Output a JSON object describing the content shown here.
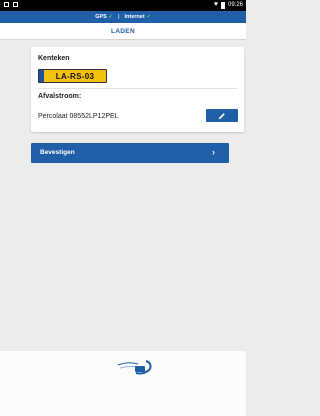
{
  "status_bar": {
    "time": "09:26"
  },
  "connection": {
    "gps_label": "GPS",
    "internet_label": "Internet",
    "gps_ok_icon": "check-icon",
    "internet_ok_icon": "check-icon"
  },
  "header": {
    "title": "LADEN"
  },
  "card": {
    "kenteken_label": "Kenteken",
    "kenteken_value": "LA-RS-03",
    "afvalstroom_label": "Afvalstroom:",
    "afvalstroom_value": "Percolaat 08552LP12PEL",
    "edit_icon": "pencil-icon"
  },
  "confirm": {
    "label": "Bevestigen",
    "arrow_icon": "chevron-right-icon"
  },
  "colors": {
    "primary": "#1f5fa7",
    "plate_yellow": "#f4c20d",
    "ok_green": "#4fd35a",
    "background": "#ececec"
  }
}
